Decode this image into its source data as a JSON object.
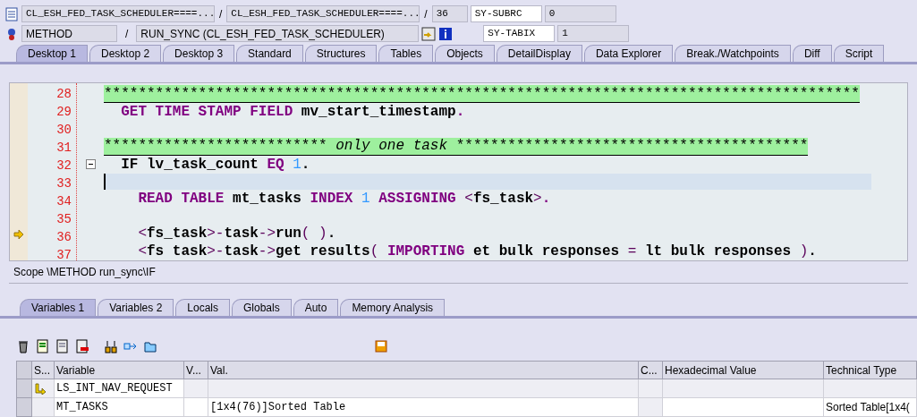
{
  "header": {
    "row1": {
      "program": "CL_ESH_FED_TASK_SCHEDULER====...",
      "separator_1": "/",
      "include": "CL_ESH_FED_TASK_SCHEDULER====...",
      "separator_2": "/",
      "line": "36",
      "field_name": "SY-SUBRC",
      "field_value": "0"
    },
    "row2": {
      "event_type": "METHOD",
      "separator": "/",
      "event": "RUN_SYNC (CL_ESH_FED_TASK_SCHEDULER)",
      "field_name": "SY-TABIX",
      "field_value": "1"
    }
  },
  "tabs": [
    {
      "label": "Desktop 1",
      "selected": true
    },
    {
      "label": "Desktop 2",
      "selected": false
    },
    {
      "label": "Desktop 3",
      "selected": false
    },
    {
      "label": "Standard",
      "selected": false
    },
    {
      "label": "Structures",
      "selected": false
    },
    {
      "label": "Tables",
      "selected": false
    },
    {
      "label": "Objects",
      "selected": false
    },
    {
      "label": "DetailDisplay",
      "selected": false
    },
    {
      "label": "Data Explorer",
      "selected": false
    },
    {
      "label": "Break./Watchpoints",
      "selected": false
    },
    {
      "label": "Diff",
      "selected": false
    },
    {
      "label": "Script",
      "selected": false
    }
  ],
  "code": [
    {
      "number": "28",
      "kind": "comment",
      "current": false,
      "arrow": false,
      "fold": false,
      "segments": [
        {
          "kind": "plain",
          "text": "****************************************************************************************"
        }
      ]
    },
    {
      "number": "29",
      "kind": "code",
      "current": false,
      "arrow": false,
      "fold": false,
      "segments": [
        {
          "kind": "kw",
          "text": "  GET TIME STAMP FIELD "
        },
        {
          "kind": "id",
          "text": "mv_start_timestamp"
        },
        {
          "kind": "kw",
          "text": "."
        }
      ]
    },
    {
      "number": "30",
      "kind": "code",
      "current": false,
      "arrow": false,
      "fold": false
    },
    {
      "number": "31",
      "kind": "comment",
      "current": false,
      "arrow": false,
      "fold": false,
      "segments": [
        {
          "kind": "plain",
          "text": "************************** "
        },
        {
          "kind": "italic",
          "text": "only one task"
        },
        {
          "kind": "plain",
          "text": " *****************************************"
        }
      ]
    },
    {
      "number": "32",
      "kind": "code",
      "current": false,
      "arrow": false,
      "fold": true,
      "segments": [
        {
          "kind": "id",
          "text": "  IF lv_task_count "
        },
        {
          "kind": "kw",
          "text": "EQ "
        },
        {
          "kind": "num",
          "text": "1"
        },
        {
          "kind": "id",
          "text": "."
        }
      ]
    },
    {
      "number": "33",
      "kind": "code",
      "current": true,
      "arrow": false,
      "fold": false
    },
    {
      "number": "34",
      "kind": "code",
      "current": false,
      "arrow": false,
      "fold": false,
      "segments": [
        {
          "kind": "kw",
          "text": "    READ TABLE "
        },
        {
          "kind": "id",
          "text": "mt_tasks "
        },
        {
          "kind": "kw",
          "text": "INDEX "
        },
        {
          "kind": "num",
          "text": "1 "
        },
        {
          "kind": "kw",
          "text": "ASSIGNING "
        },
        {
          "kind": "plain",
          "text": "<"
        },
        {
          "kind": "id",
          "text": "fs_task"
        },
        {
          "kind": "plain",
          "text": ">"
        },
        {
          "kind": "kw",
          "text": "."
        }
      ]
    },
    {
      "number": "35",
      "kind": "code",
      "current": false,
      "arrow": false,
      "fold": false
    },
    {
      "number": "36",
      "kind": "code",
      "current": false,
      "arrow": true,
      "fold": false,
      "segments": [
        {
          "kind": "plain",
          "text": "    <"
        },
        {
          "kind": "id",
          "text": "fs_task"
        },
        {
          "kind": "plain",
          "text": ">-"
        },
        {
          "kind": "id",
          "text": "task"
        },
        {
          "kind": "plain",
          "text": "->"
        },
        {
          "kind": "id",
          "text": "run"
        },
        {
          "kind": "plain",
          "text": "( )"
        },
        {
          "kind": "id",
          "text": "."
        }
      ]
    },
    {
      "number": "37",
      "kind": "code",
      "current": false,
      "arrow": false,
      "fold": false,
      "segments": [
        {
          "kind": "plain",
          "text": "    <"
        },
        {
          "kind": "id",
          "text": "fs task"
        },
        {
          "kind": "plain",
          "text": ">-"
        },
        {
          "kind": "id",
          "text": "task"
        },
        {
          "kind": "plain",
          "text": "->"
        },
        {
          "kind": "id",
          "text": "get results"
        },
        {
          "kind": "plain",
          "text": "( "
        },
        {
          "kind": "kw",
          "text": "IMPORTING "
        },
        {
          "kind": "id",
          "text": "et bulk responses "
        },
        {
          "kind": "plain",
          "text": "= "
        },
        {
          "kind": "id",
          "text": "lt bulk responses "
        },
        {
          "kind": "plain",
          "text": ")"
        },
        {
          "kind": "id",
          "text": "."
        }
      ]
    }
  ],
  "scope": "Scope \\METHOD run_sync\\IF",
  "var_tabs": [
    {
      "label": "Variables 1",
      "selected": true
    },
    {
      "label": "Variables 2",
      "selected": false
    },
    {
      "label": "Locals",
      "selected": false
    },
    {
      "label": "Globals",
      "selected": false
    },
    {
      "label": "Auto",
      "selected": false
    },
    {
      "label": "Memory Analysis",
      "selected": false
    }
  ],
  "table": {
    "columns": [
      "S...",
      "Variable",
      "V...",
      "Val.",
      "C...",
      "Hexadecimal Value",
      "Technical Type"
    ],
    "rows": [
      {
        "marked": true,
        "variable": "LS_INT_NAV_REQUEST"
      },
      {
        "marked": false,
        "variable": "MT_TASKS",
        "value": "[1x4(76)]Sorted Table",
        "type": "Sorted Table[1x4("
      }
    ]
  }
}
